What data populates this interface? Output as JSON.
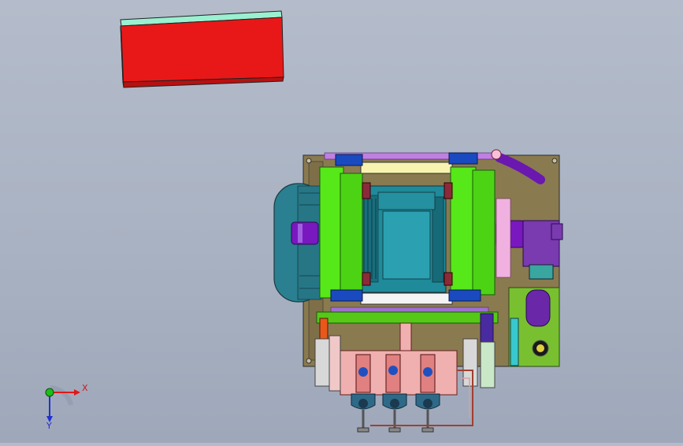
{
  "viewport": {
    "background_top": "#b4bccb",
    "background_bottom": "#9ea8ba"
  },
  "triad": {
    "x_label": "X",
    "y_label": "Y",
    "x_color": "#e01818",
    "y_color": "#2030d0",
    "z_color": "#18c018"
  },
  "parts": {
    "block_color": "#e81818",
    "block_top_color": "#9af0d0",
    "base_color": "#8a7a50",
    "motor_color": "#1f8a9a",
    "pump_color": "#56e818",
    "coupling_color": "#7a18c0",
    "valve_block_color": "#f0b0b0",
    "valve_color": "#2e6a88"
  }
}
